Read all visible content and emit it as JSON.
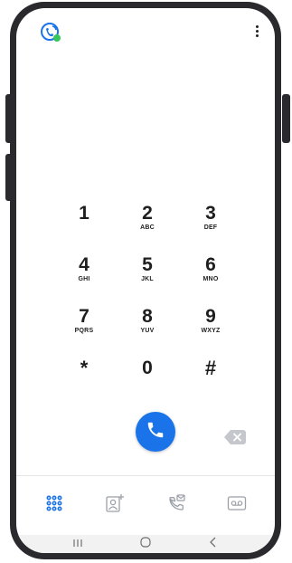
{
  "keypad": {
    "keys": [
      {
        "digit": "1",
        "letters": ""
      },
      {
        "digit": "2",
        "letters": "ABC"
      },
      {
        "digit": "3",
        "letters": "DEF"
      },
      {
        "digit": "4",
        "letters": "GHI"
      },
      {
        "digit": "5",
        "letters": "JKL"
      },
      {
        "digit": "6",
        "letters": "MNO"
      },
      {
        "digit": "7",
        "letters": "PQRS"
      },
      {
        "digit": "8",
        "letters": "YUV"
      },
      {
        "digit": "9",
        "letters": "WXYZ"
      },
      {
        "digit": "*",
        "letters": ""
      },
      {
        "digit": "0",
        "letters": ""
      },
      {
        "digit": "#",
        "letters": ""
      }
    ]
  },
  "icons": {
    "app_logo": "app-logo-icon",
    "more": "more-vertical-icon",
    "call": "phone-icon",
    "backspace": "backspace-icon",
    "nav": [
      "dialpad-icon",
      "add-contact-icon",
      "call-history-icon",
      "voicemail-icon"
    ],
    "system": [
      "recent-apps-icon",
      "home-icon",
      "back-icon"
    ]
  },
  "colors": {
    "accent": "#1a73e8",
    "logo_green": "#34c759",
    "phone_frame": "#2a2a2e",
    "icon_gray": "#9aa0a6"
  }
}
